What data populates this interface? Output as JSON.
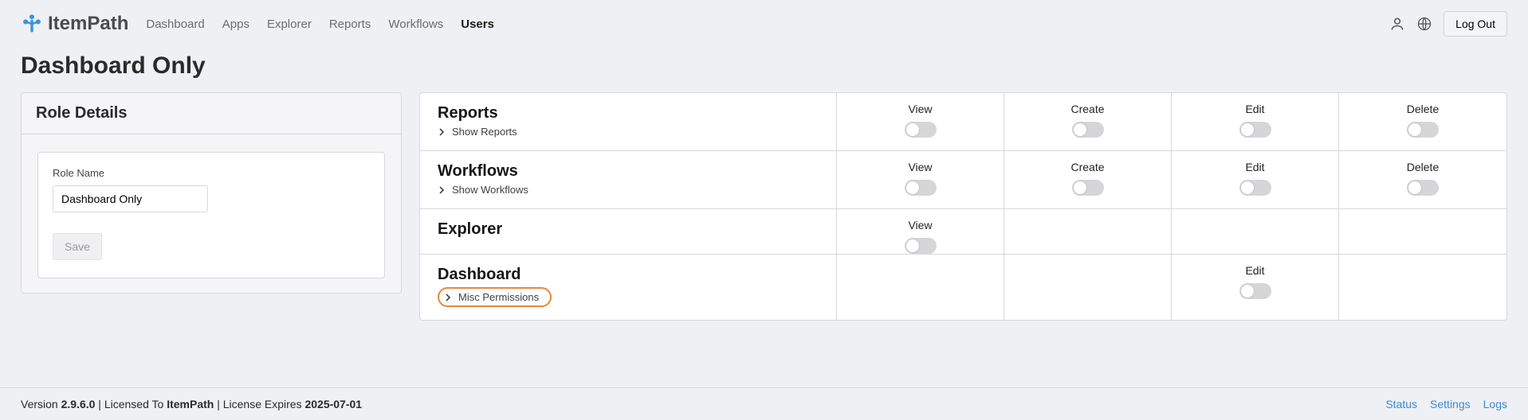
{
  "brand": "ItemPath",
  "nav": {
    "items": [
      {
        "label": "Dashboard",
        "active": false
      },
      {
        "label": "Apps",
        "active": false
      },
      {
        "label": "Explorer",
        "active": false
      },
      {
        "label": "Reports",
        "active": false
      },
      {
        "label": "Workflows",
        "active": false
      },
      {
        "label": "Users",
        "active": true
      }
    ],
    "logout": "Log Out"
  },
  "page": {
    "title": "Dashboard Only"
  },
  "role_details": {
    "header": "Role Details",
    "name_label": "Role Name",
    "name_value": "Dashboard Only",
    "save": "Save"
  },
  "perm_cols": {
    "view": "View",
    "create": "Create",
    "edit": "Edit",
    "delete": "Delete"
  },
  "perms": [
    {
      "title": "Reports",
      "sub": "Show Reports",
      "cols": [
        "view",
        "create",
        "edit",
        "delete"
      ],
      "highlighted": false
    },
    {
      "title": "Workflows",
      "sub": "Show Workflows",
      "cols": [
        "view",
        "create",
        "edit",
        "delete"
      ],
      "highlighted": false
    },
    {
      "title": "Explorer",
      "sub": null,
      "cols": [
        "view"
      ],
      "highlighted": false
    },
    {
      "title": "Dashboard",
      "sub": "Misc Permissions",
      "cols": [
        "edit"
      ],
      "highlighted": true,
      "edit_col_index": 2
    }
  ],
  "footer": {
    "version_label": "Version ",
    "version": "2.9.6.0",
    "licensed_label": " | Licensed To ",
    "licensed_to": "ItemPath",
    "expires_label": " | License Expires ",
    "expires": "2025-07-01",
    "links": [
      "Status",
      "Settings",
      "Logs"
    ]
  }
}
